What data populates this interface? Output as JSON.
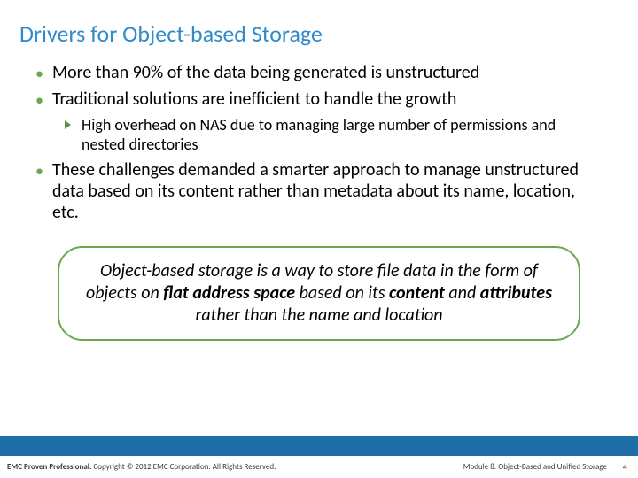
{
  "title": "Drivers for Object-based Storage",
  "bullets": {
    "b1": "More than 90% of the data being generated is unstructured",
    "b2": "Traditional solutions are inefficient to handle the growth",
    "b2_sub": "High overhead on NAS due to managing large number of permissions and nested directories",
    "b3": "These challenges demanded a smarter approach to manage unstructured data based on its content rather than metadata about its name, location, etc."
  },
  "callout": {
    "pre": "Object-based storage is a way to store file data in the form of objects on ",
    "bold1": "flat address space",
    "mid1": " based on its ",
    "bold2": "content",
    "mid2": "  and ",
    "bold3": "attributes",
    "post": " rather than the name and location"
  },
  "footer": {
    "proven_bold": "EMC Proven Professional.",
    "proven_rest": " Copyright © 2012 EMC Corporation. All Rights Reserved.",
    "module": "Module 8: Object-Based and Unified Storage",
    "page": "4"
  }
}
